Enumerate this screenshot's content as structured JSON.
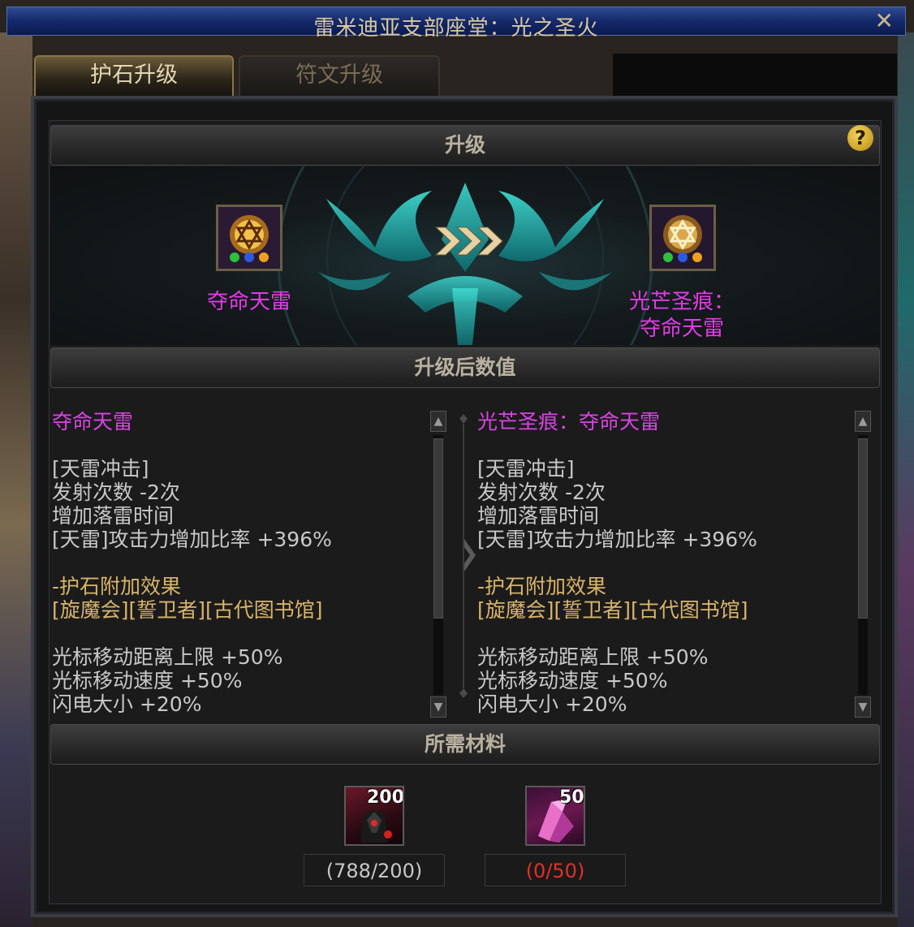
{
  "window": {
    "title": "雷米迪亚支部座堂：光之圣火",
    "close_label": "✕"
  },
  "tabs": [
    {
      "label": "护石升级",
      "active": true
    },
    {
      "label": "符文升级",
      "active": false
    }
  ],
  "sections": {
    "upgrade": "升级",
    "after_values": "升级后数值",
    "materials": "所需材料"
  },
  "help_label": "?",
  "upgrade": {
    "source_name": "夺命天雷",
    "target_name_line1": "光芒圣痕：",
    "target_name_line2": "夺命天雷"
  },
  "stats": {
    "left": {
      "title": "夺命天雷",
      "lines": [
        "[天雷冲击]",
        "发射次数 -2次",
        "增加落雷时间",
        "[天雷]攻击力增加比率 +396%"
      ],
      "bonus_header": "-护石附加效果",
      "bonus_sets": "[旋魔会][誓卫者][古代图书馆]",
      "extra": [
        "光标移动距离上限 +50%",
        "光标移动速度 +50%",
        "闪电大小 +20%"
      ]
    },
    "right": {
      "title": "光芒圣痕：夺命天雷",
      "lines": [
        "[天雷冲击]",
        "发射次数 -2次",
        "增加落雷时间",
        "[天雷]攻击力增加比率 +396%"
      ],
      "bonus_header": "-护石附加效果",
      "bonus_sets": "[旋魔会][誓卫者][古代图书馆]",
      "extra": [
        "光标移动距离上限 +50%",
        "光标移动速度 +50%",
        "闪电大小 +20%"
      ]
    }
  },
  "materials": [
    {
      "count": "200",
      "owned": "(788/200)",
      "status_color": "#c7c7c7"
    },
    {
      "count": "50",
      "owned": "(0/50)",
      "status_color": "#e0302a"
    }
  ],
  "colors": {
    "item_name": "#e23ae6",
    "stat_title": "#d944e4",
    "stat_gold": "#d8b46a",
    "insufficient": "#e0302a"
  }
}
